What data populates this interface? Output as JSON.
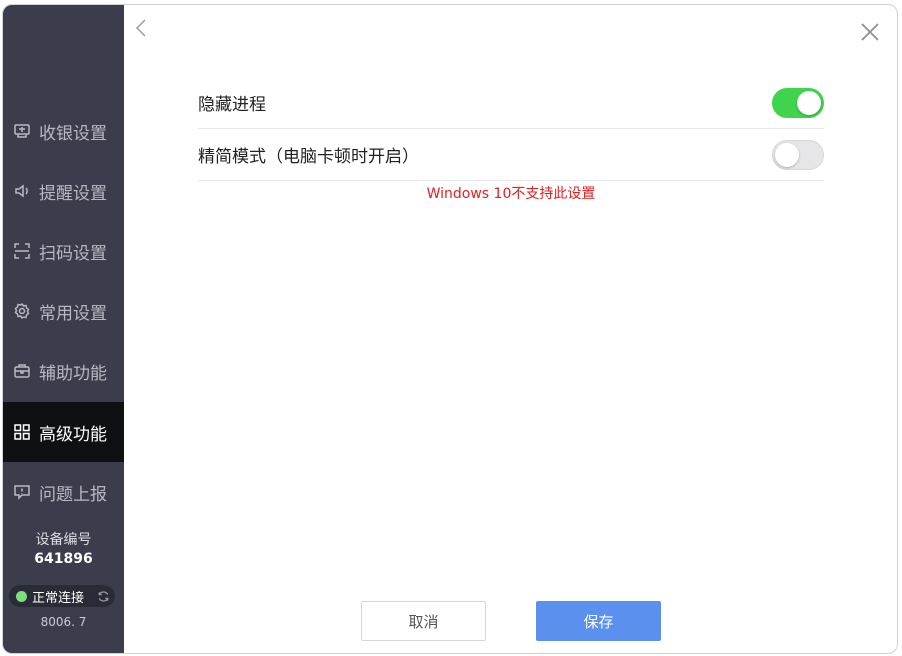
{
  "sidebar": {
    "items": [
      {
        "label": "收银设置",
        "icon": "cashier-icon",
        "active": false
      },
      {
        "label": "提醒设置",
        "icon": "speaker-icon",
        "active": false
      },
      {
        "label": "扫码设置",
        "icon": "scan-icon",
        "active": false
      },
      {
        "label": "常用设置",
        "icon": "gear-icon",
        "active": false
      },
      {
        "label": "辅助功能",
        "icon": "toolbox-icon",
        "active": false
      },
      {
        "label": "高级功能",
        "icon": "grid-icon",
        "active": true
      },
      {
        "label": "问题上报",
        "icon": "report-icon",
        "active": false
      }
    ],
    "device_label": "设备编号",
    "device_id": "641896",
    "connection_status": "正常连接",
    "connection_color": "#7ee07c",
    "version": "8006. 7"
  },
  "settings": {
    "rows": [
      {
        "label": "隐藏进程",
        "toggle_on": true
      },
      {
        "label": "精简模式（电脑卡顿时开启）",
        "toggle_on": false
      }
    ],
    "warning": "Windows 10不支持此设置",
    "warning_color": "#e02020"
  },
  "footer": {
    "cancel_label": "取消",
    "save_label": "保存",
    "save_color": "#5b90ef"
  },
  "colors": {
    "sidebar_bg": "#3b3d4c",
    "sidebar_active_bg": "#0f1014",
    "toggle_on": "#3fd44c"
  }
}
